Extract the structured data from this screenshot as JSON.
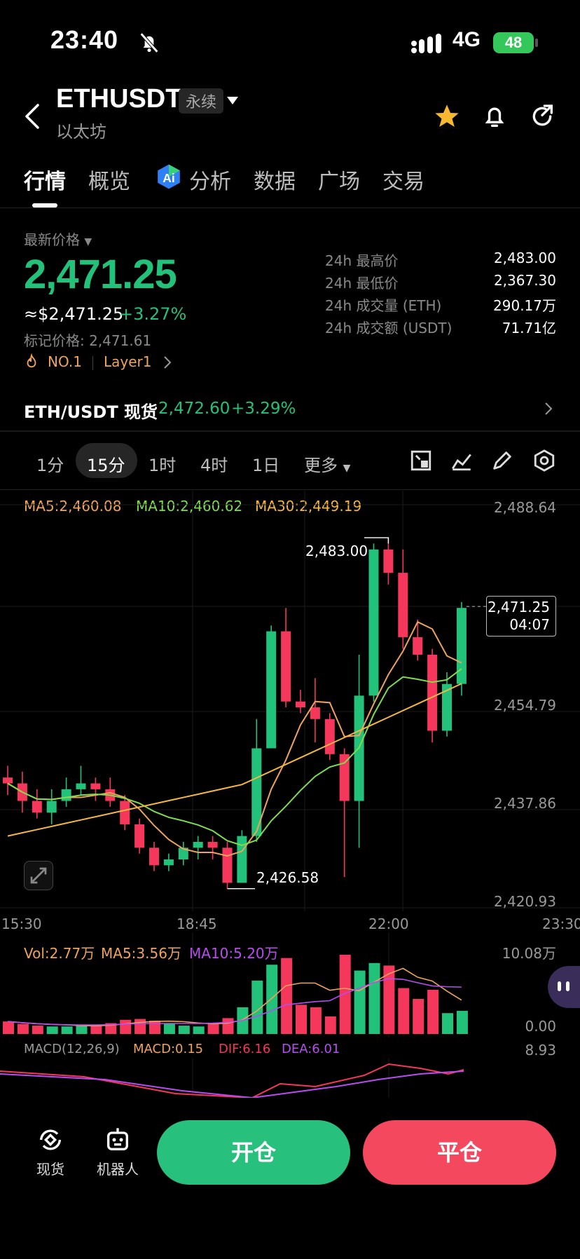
{
  "status": {
    "time": "23:40",
    "network": "4G",
    "battery": "48"
  },
  "header": {
    "symbol": "ETHUSDT",
    "contract_type": "永续",
    "name_cn": "以太坊"
  },
  "tabs": [
    "行情",
    "概览",
    "分析",
    "数据",
    "广场",
    "交易"
  ],
  "price": {
    "label": "最新价格",
    "last": "2,471.25",
    "usd": "≈$2,471.25",
    "change": "+3.27%",
    "mark_price": "标记价格: 2,471.61",
    "rank_tag": "NO.1",
    "sector_tag": "Layer1"
  },
  "stats": [
    {
      "label": "24h 最高价",
      "value": "2,483.00"
    },
    {
      "label": "24h 最低价",
      "value": "2,367.30"
    },
    {
      "label": "24h 成交量 (ETH)",
      "value": "290.17万"
    },
    {
      "label": "24h 成交额 (USDT)",
      "value": "71.71亿"
    }
  ],
  "spot": {
    "label": "ETH/USDT 现货",
    "price": "2,472.60",
    "change": "+3.29%"
  },
  "intervals": [
    "1分",
    "15分",
    "1时",
    "4时",
    "1日",
    "更多"
  ],
  "chart": {
    "ma5": "MA5:2,460.08",
    "ma10": "MA10:2,460.62",
    "ma30": "MA30:2,449.19",
    "y_ticks": [
      "2,488.64",
      "2,454.79",
      "2,437.86",
      "2,420.93"
    ],
    "x_ticks": [
      "15:30",
      "18:45",
      "22:00",
      "23:30"
    ],
    "high_label": "2,483.00",
    "low_label": "2,426.58",
    "current_price": "2,471.25",
    "countdown": "04:07",
    "colors": {
      "up": "#23c27b",
      "down": "#f4375a",
      "ma5": "#f0a35a",
      "ma10": "#7fdc4c",
      "ma30": "#f5b740",
      "macd_dif": "#f4375a",
      "macd_dea": "#b84cf0"
    }
  },
  "volume": {
    "vol": "Vol:2.77万",
    "ma5": "MA5:3.56万",
    "ma10": "MA10:5.20万",
    "max": "10.08万",
    "min": "0.00"
  },
  "macd": {
    "title": "MACD(12,26,9)",
    "macd": "MACD:0.15",
    "dif": "DIF:6.16",
    "dea": "DEA:6.01",
    "max": "8.93"
  },
  "bottom": {
    "spot_label": "现货",
    "bot_label": "机器人",
    "open_label": "开仓",
    "close_label": "平仓"
  },
  "chart_data": {
    "type": "candlestick",
    "candles": [
      [
        2442,
        2441,
        2444,
        2439
      ],
      [
        2441,
        2438,
        2443,
        2436
      ],
      [
        2438,
        2436,
        2440,
        2435
      ],
      [
        2436,
        2438,
        2440,
        2434
      ],
      [
        2438,
        2440,
        2442,
        2437
      ],
      [
        2440,
        2441,
        2444,
        2439
      ],
      [
        2441,
        2440,
        2442,
        2438
      ],
      [
        2440,
        2438,
        2442,
        2437
      ],
      [
        2438,
        2434,
        2439,
        2433
      ],
      [
        2434,
        2430,
        2435,
        2429
      ],
      [
        2430,
        2427,
        2431,
        2426
      ],
      [
        2427,
        2428,
        2429,
        2426
      ],
      [
        2428,
        2430,
        2431,
        2427
      ],
      [
        2430,
        2431,
        2432,
        2428
      ],
      [
        2431,
        2430,
        2432,
        2428
      ],
      [
        2430,
        2424,
        2431,
        2423
      ],
      [
        2424,
        2432,
        2433,
        2424
      ],
      [
        2432,
        2447,
        2452,
        2431
      ],
      [
        2447,
        2467,
        2468,
        2447
      ],
      [
        2467,
        2455,
        2471,
        2454
      ],
      [
        2455,
        2454,
        2457,
        2453
      ],
      [
        2454,
        2452,
        2459,
        2448
      ],
      [
        2452,
        2446,
        2453,
        2445
      ],
      [
        2446,
        2438,
        2447,
        2425
      ],
      [
        2438,
        2456,
        2463,
        2430
      ],
      [
        2456,
        2481,
        2482,
        2455
      ],
      [
        2481,
        2477,
        2483,
        2475
      ],
      [
        2477,
        2466,
        2481,
        2464
      ],
      [
        2466,
        2463,
        2469,
        2462
      ],
      [
        2463,
        2450,
        2464,
        2448
      ],
      [
        2450,
        2458,
        2460,
        2449
      ],
      [
        2458,
        2471,
        2472,
        2456
      ]
    ],
    "volumes": [
      1.5,
      1.2,
      1.0,
      0.9,
      0.9,
      1.0,
      1.1,
      1.3,
      1.7,
      1.8,
      1.6,
      1.3,
      1.0,
      0.9,
      1.3,
      1.9,
      3.2,
      6.4,
      8.3,
      9.1,
      3.5,
      3.2,
      2.1,
      9.5,
      7.6,
      8.5,
      8.2,
      5.5,
      4.2,
      5.3,
      2.5,
      2.77
    ],
    "y_range": [
      2420.93,
      2488.64
    ]
  }
}
